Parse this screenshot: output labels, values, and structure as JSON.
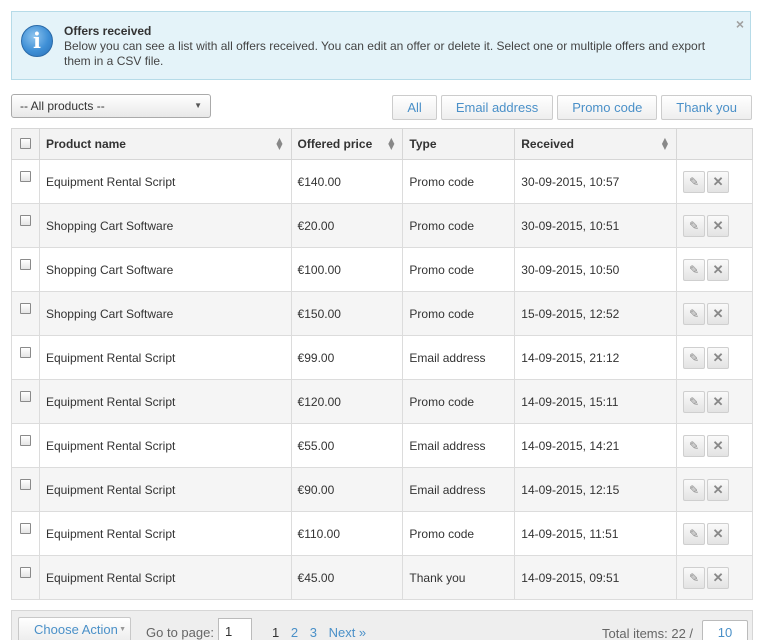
{
  "notice": {
    "title": "Offers received",
    "text": "Below you can see a list with all offers received. You can edit an offer or delete it. Select one or multiple offers and export them in a CSV file.",
    "icon": "info-icon",
    "close_glyph": "×"
  },
  "filters": {
    "product_select": "-- All products --",
    "tabs": [
      "All",
      "Email address",
      "Promo code",
      "Thank you"
    ]
  },
  "table": {
    "headers": {
      "name": "Product name",
      "price": "Offered price",
      "type": "Type",
      "received": "Received"
    },
    "rows": [
      {
        "name": "Equipment Rental Script",
        "price": "€140.00",
        "type": "Promo code",
        "received": "30-09-2015, 10:57"
      },
      {
        "name": "Shopping Cart Software",
        "price": "€20.00",
        "type": "Promo code",
        "received": "30-09-2015, 10:51"
      },
      {
        "name": "Shopping Cart Software",
        "price": "€100.00",
        "type": "Promo code",
        "received": "30-09-2015, 10:50"
      },
      {
        "name": "Shopping Cart Software",
        "price": "€150.00",
        "type": "Promo code",
        "received": "15-09-2015, 12:52"
      },
      {
        "name": "Equipment Rental Script",
        "price": "€99.00",
        "type": "Email address",
        "received": "14-09-2015, 21:12"
      },
      {
        "name": "Equipment Rental Script",
        "price": "€120.00",
        "type": "Promo code",
        "received": "14-09-2015, 15:11"
      },
      {
        "name": "Equipment Rental Script",
        "price": "€55.00",
        "type": "Email address",
        "received": "14-09-2015, 14:21"
      },
      {
        "name": "Equipment Rental Script",
        "price": "€90.00",
        "type": "Email address",
        "received": "14-09-2015, 12:15"
      },
      {
        "name": "Equipment Rental Script",
        "price": "€110.00",
        "type": "Promo code",
        "received": "14-09-2015, 11:51"
      },
      {
        "name": "Equipment Rental Script",
        "price": "€45.00",
        "type": "Thank you",
        "received": "14-09-2015, 09:51"
      }
    ]
  },
  "footer": {
    "choose_action": "Choose Action",
    "goto_label": "Go to page:",
    "goto_value": "1",
    "pages": [
      "1",
      "2",
      "3"
    ],
    "current_page": "1",
    "next_label": "Next »",
    "total_label": "Total items: 22 /",
    "per_page": "10"
  }
}
